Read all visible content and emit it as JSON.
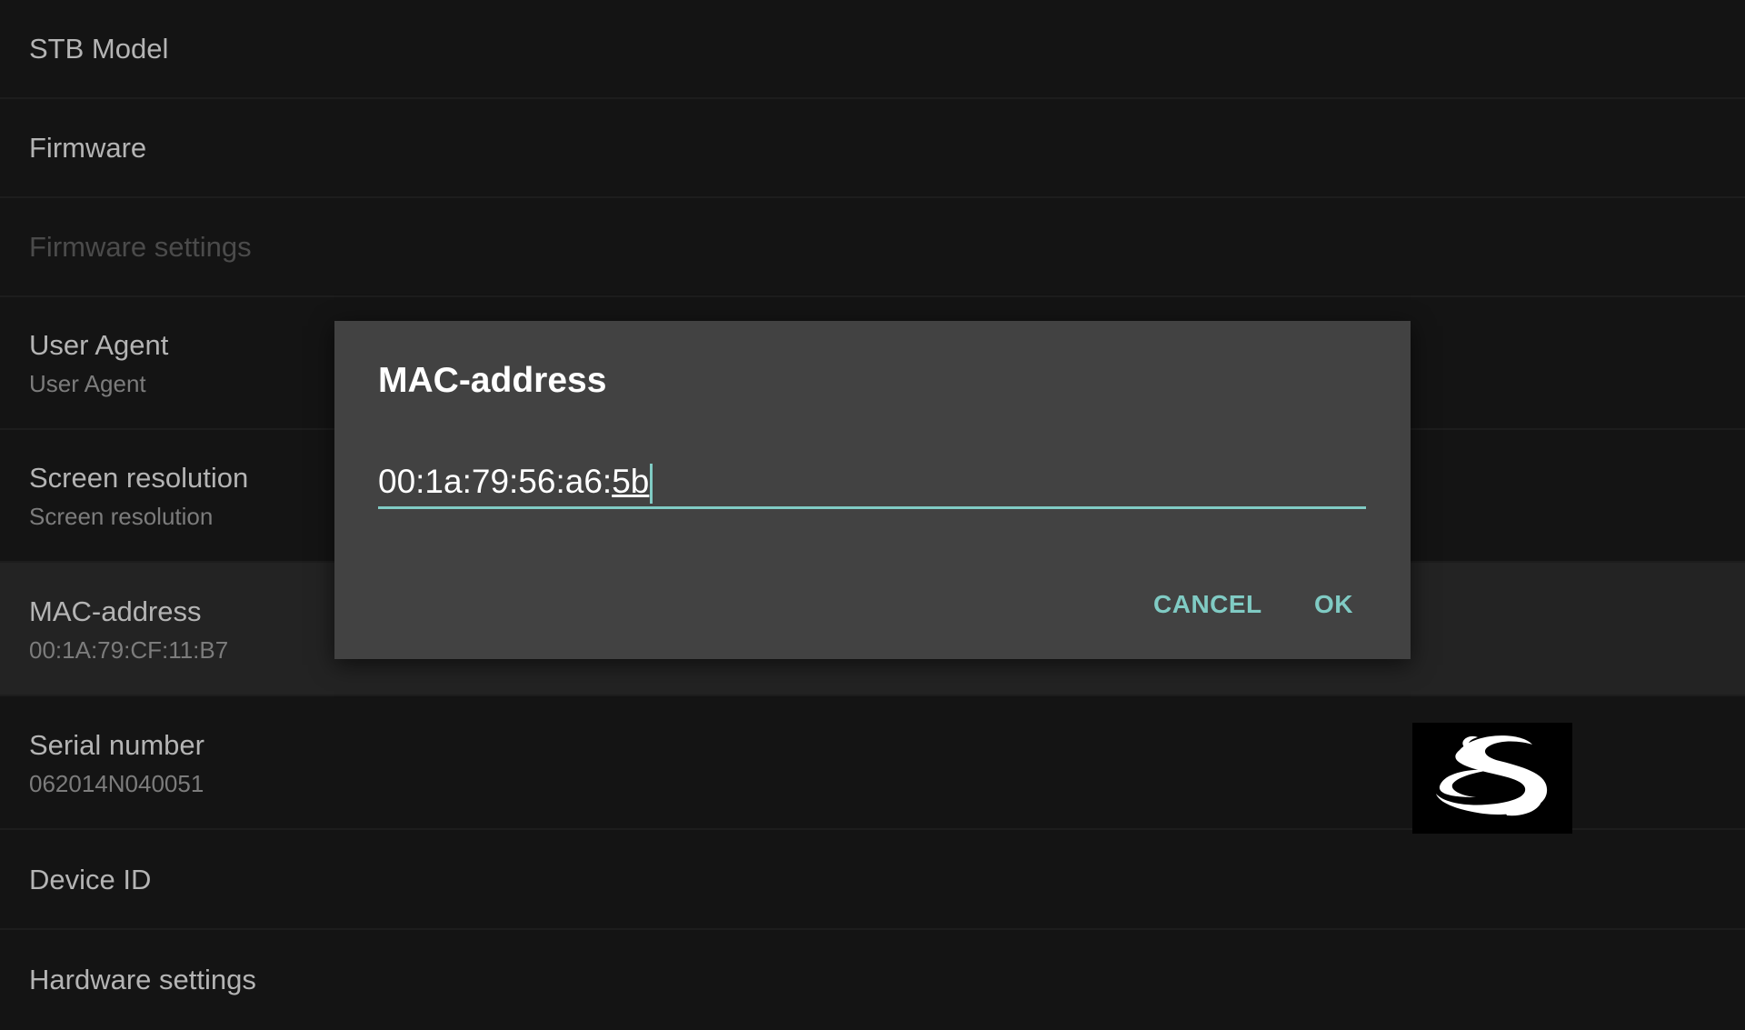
{
  "settings": {
    "items": [
      {
        "title": "STB Model"
      },
      {
        "title": "Firmware"
      },
      {
        "title": "Firmware settings"
      },
      {
        "title": "User Agent",
        "summary": "User Agent"
      },
      {
        "title": "Screen resolution",
        "summary": "Screen resolution"
      },
      {
        "title": "MAC-address",
        "summary": "00:1A:79:CF:11:B7"
      },
      {
        "title": "Serial number",
        "summary": "062014N040051"
      },
      {
        "title": "Device ID"
      },
      {
        "title": "Hardware settings"
      }
    ]
  },
  "dialog": {
    "title": "MAC-address",
    "input_value_prefix": "00:1a:79:56:a6:",
    "input_value_composing": "5b",
    "cancel_label": "CANCEL",
    "ok_label": "OK"
  },
  "colors": {
    "accent": "#80cbc4",
    "dialog_bg": "#424242",
    "page_bg": "#141414"
  },
  "icons": {
    "logo": "gothic-s-logo"
  }
}
